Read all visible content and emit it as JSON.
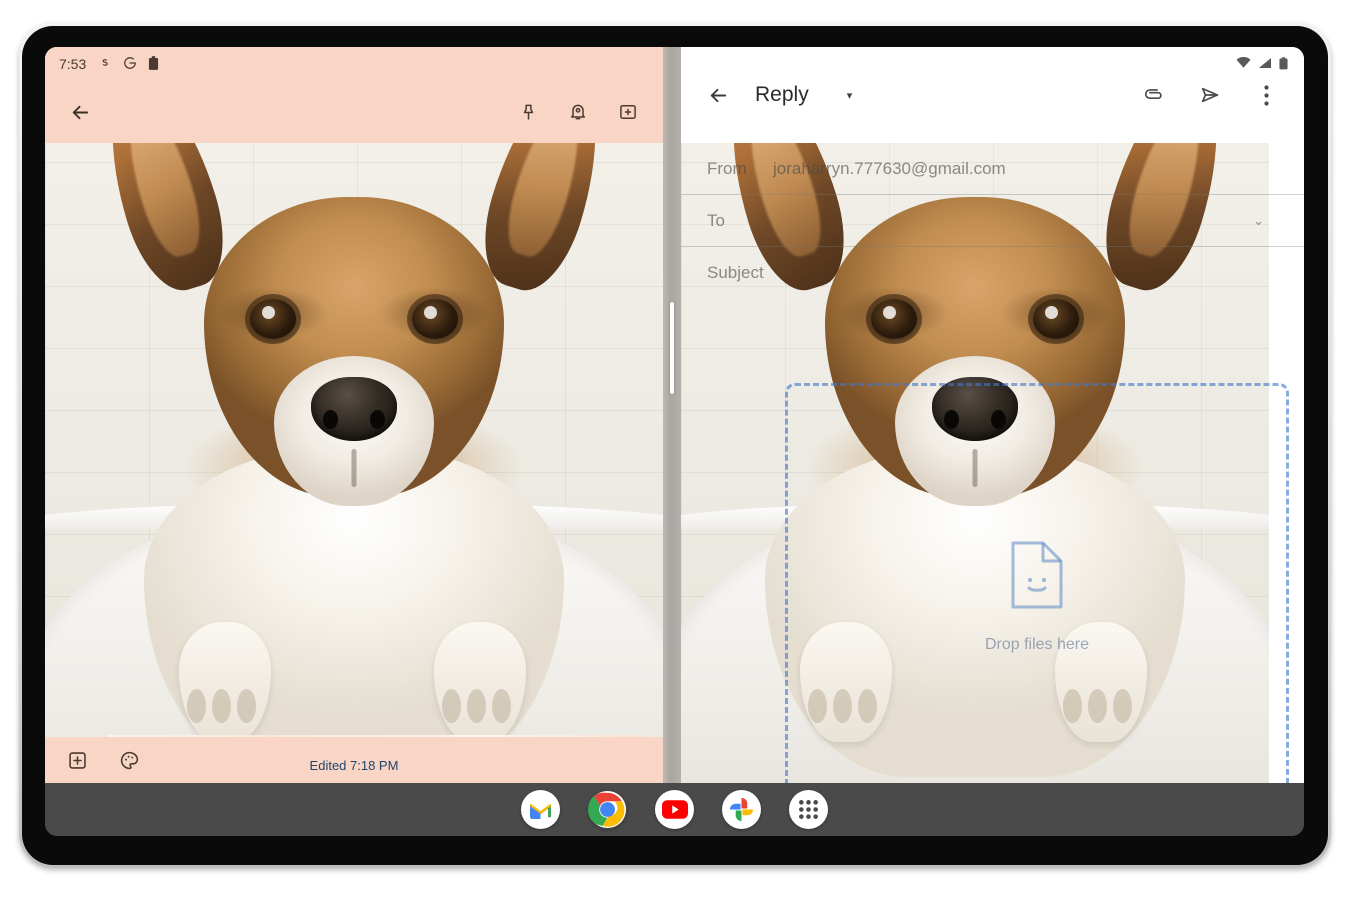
{
  "device": {
    "type": "android-tablet",
    "orientation": "landscape"
  },
  "status_bar": {
    "time": "7:53",
    "left_icons": [
      "skype-icon",
      "google-icon",
      "battery-saver-icon"
    ],
    "right_icons": [
      "wifi-icon",
      "signal-icon",
      "battery-icon"
    ]
  },
  "left_panel": {
    "app": "Google Keep",
    "header_color": "#f8d5c4",
    "back_label": "←",
    "toolbar_icons": [
      "pin-icon",
      "reminder-bell-icon",
      "archive-icon"
    ],
    "note": {
      "edited_label": "Edited 7:18 PM",
      "card_color": "#3a72a8"
    },
    "bottom_icons": [
      "add-box-icon",
      "palette-icon"
    ]
  },
  "right_panel": {
    "app": "Gmail",
    "toolbar": {
      "back_label": "←",
      "title": "Reply",
      "dropdown_caret": "▾",
      "icons": [
        "attach-paperclip-icon",
        "send-icon",
        "overflow-menu-icon"
      ]
    },
    "compose": {
      "from_label": "From",
      "from_value": "joraharryn.777630@gmail.com",
      "to_label": "To",
      "to_value": "",
      "to_chevron": "⌄",
      "subject_label": "Subject",
      "subject_value": ""
    },
    "drop_zone": {
      "label": "Drop files here",
      "icon": "file-smile-icon",
      "border_color": "#1a73e8",
      "active": true
    }
  },
  "dock": {
    "background": "#4a4a4a",
    "apps": [
      {
        "name": "gmail-app-icon",
        "label": "Gmail"
      },
      {
        "name": "chrome-app-icon",
        "label": "Chrome"
      },
      {
        "name": "youtube-app-icon",
        "label": "YouTube"
      },
      {
        "name": "photos-app-icon",
        "label": "Photos"
      },
      {
        "name": "app-drawer-icon",
        "label": "All apps"
      }
    ]
  },
  "photo": {
    "subject": "wet corgi dog in bathtub",
    "alt": "Corgi photo"
  }
}
